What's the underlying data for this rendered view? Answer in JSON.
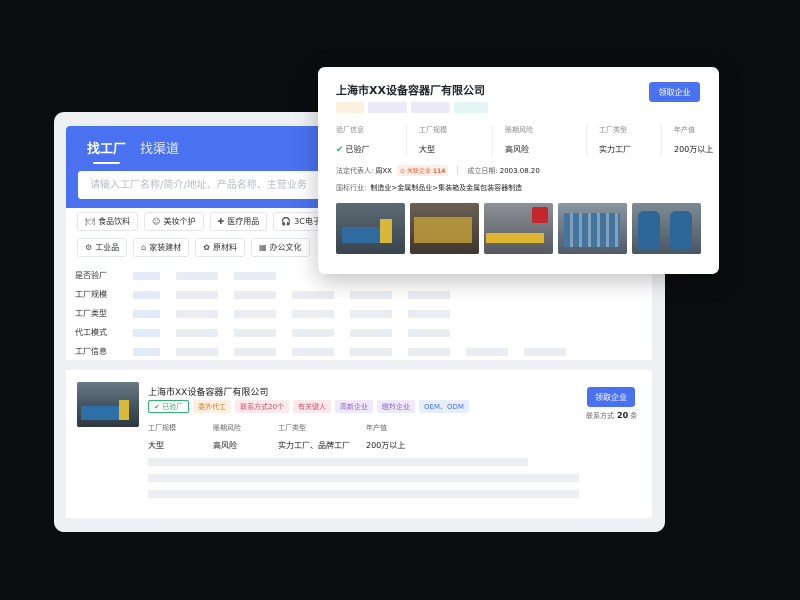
{
  "search": {
    "tabs": [
      "找工厂",
      "找渠道"
    ],
    "placeholder": "请输入工厂名称/简介/地址、产品名称、主营业务"
  },
  "categories": {
    "row1": [
      {
        "icon": "food-icon",
        "glyph": "🍽",
        "label": "食品饮料"
      },
      {
        "icon": "makeup-icon",
        "glyph": "☺",
        "label": "美妆个护"
      },
      {
        "icon": "medical-icon",
        "glyph": "✚",
        "label": "医疗用品"
      },
      {
        "icon": "headphones-icon",
        "glyph": "🎧",
        "label": "3C电子"
      }
    ],
    "row2": [
      {
        "icon": "industrial-icon",
        "glyph": "⚙",
        "label": "工业品"
      },
      {
        "icon": "furniture-icon",
        "glyph": "⌂",
        "label": "家装建材"
      },
      {
        "icon": "material-icon",
        "glyph": "✿",
        "label": "原材料"
      },
      {
        "icon": "office-icon",
        "glyph": "▦",
        "label": "办公文化"
      }
    ]
  },
  "filters": [
    "是否验厂",
    "工厂规模",
    "工厂类型",
    "代工模式",
    "工厂信息"
  ],
  "result": {
    "name": "上海市XX设备容器厂有限公司",
    "tags": [
      {
        "label": "已验厂",
        "style": "verified"
      },
      {
        "label": "委外代工",
        "style": "orange"
      },
      {
        "label": "联系方式20个",
        "style": "pink"
      },
      {
        "label": "有关键人",
        "style": "pink"
      },
      {
        "label": "高新企业",
        "style": "purple"
      },
      {
        "label": "瞪羚企业",
        "style": "purple"
      },
      {
        "label": "OEM、ODM",
        "style": "blue"
      }
    ],
    "stats": [
      {
        "label": "工厂规模",
        "value": "大型"
      },
      {
        "label": "賬期风险",
        "value": "高风险"
      },
      {
        "label": "工厂类型",
        "value": "实力工厂、品牌工厂"
      },
      {
        "label": "年产值",
        "value": "200万以上"
      }
    ],
    "claim": "领取企业",
    "contact_label": "联系方式",
    "contact_count": "20",
    "contact_unit": "条"
  },
  "popup": {
    "name": "上海市XX设备容器厂有限公司",
    "tag_colors": [
      "#fdf0de",
      "#ece9fb",
      "#ece9fb",
      "#e3f6f3"
    ],
    "claim": "领取企业",
    "stats": [
      {
        "label": "验厂信息",
        "value": "已验厂"
      },
      {
        "label": "工厂规模",
        "value": "大型"
      },
      {
        "label": "賬期风险",
        "value": "高风险"
      },
      {
        "label": "工厂类型",
        "value": "实力工厂"
      },
      {
        "label": "年产值",
        "value": "200万以上"
      }
    ],
    "legal_label": "法定代表人:",
    "legal_value": "周XX",
    "related_label": "关联企业",
    "related_count": "114",
    "est_label": "成立日期:",
    "est_value": "2003.08.20",
    "industry_label": "国标行业:",
    "industry_value": "制造业>金属制品业>集装箱及金属包装容器制造"
  },
  "colors": {
    "primary": "#4a72f0",
    "verified": "#2bb56f"
  }
}
